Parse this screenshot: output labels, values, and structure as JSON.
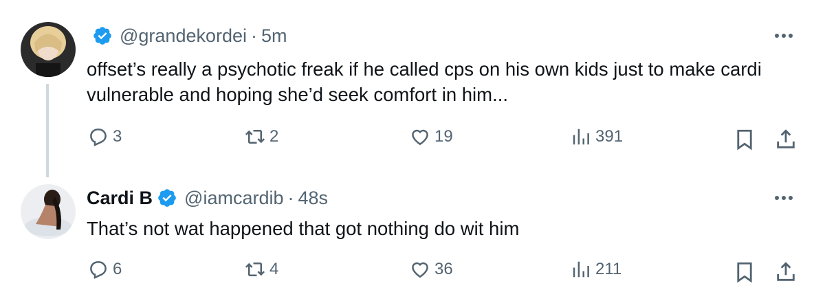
{
  "colors": {
    "verified": "#1d9bf0",
    "text": "#0f1419",
    "muted": "#536471",
    "line": "#cfd9de"
  },
  "tweets": [
    {
      "display_name": "",
      "handle": "@grandekordei",
      "time": "5m",
      "separator": "·",
      "text": "offset’s really a psychotic freak if he called cps on his own kids just to make cardi vulnerable and hoping she’d seek comfort in him...",
      "replies": "3",
      "reposts": "2",
      "likes": "19",
      "views": "391"
    },
    {
      "display_name": "Cardi B",
      "handle": "@iamcardib",
      "time": "48s",
      "separator": "·",
      "text": "That’s not wat happened that got nothing do wit him",
      "replies": "6",
      "reposts": "4",
      "likes": "36",
      "views": "211"
    }
  ],
  "icons": [
    "verified-badge-icon",
    "more-icon",
    "reply-icon",
    "repost-icon",
    "like-icon",
    "views-icon",
    "bookmark-icon",
    "share-icon"
  ]
}
